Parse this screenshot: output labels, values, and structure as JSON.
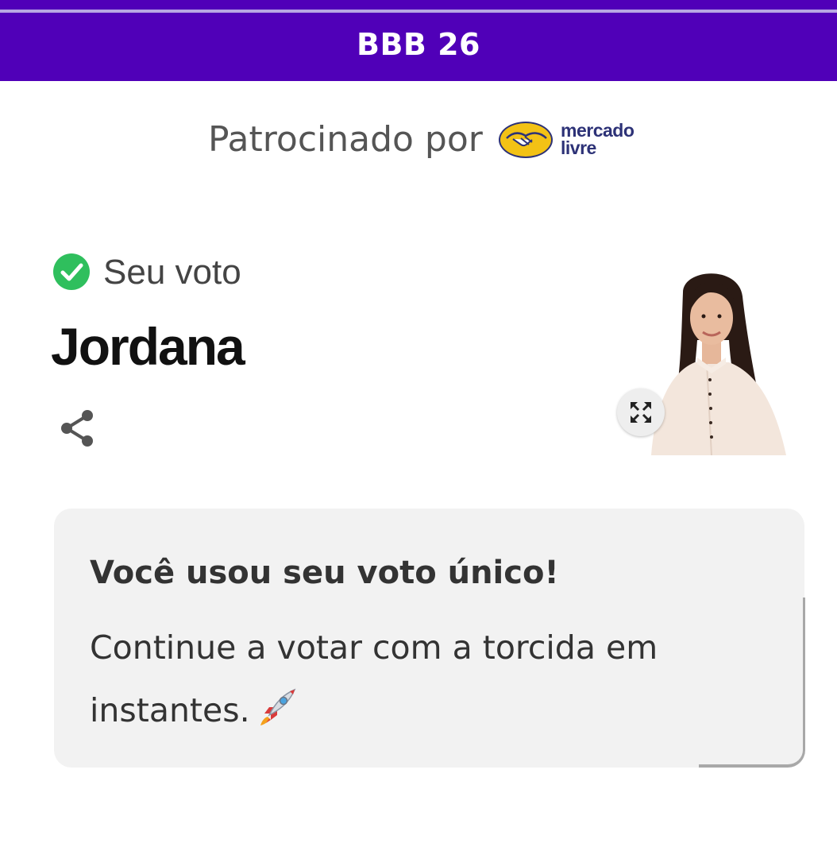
{
  "header": {
    "title": "BBB 26",
    "background_color": "#5000b8"
  },
  "sponsor": {
    "label": "Patrocinado por",
    "logo_text_line1": "mercado",
    "logo_text_line2": "livre",
    "logo_icon": "handshake-icon",
    "logo_colors": {
      "yellow": "#f3c215",
      "navy": "#2d3277"
    }
  },
  "vote": {
    "label": "Seu voto",
    "status_icon": "check-circle-icon",
    "status_color": "#2fbf5d",
    "candidate_name": "Jordana",
    "share_icon": "share-icon",
    "expand_icon": "expand-icon"
  },
  "message": {
    "title": "Você usou seu voto único!",
    "body": "Continue a votar com a torcida em instantes.",
    "emoji_icon": "rocket-icon"
  }
}
